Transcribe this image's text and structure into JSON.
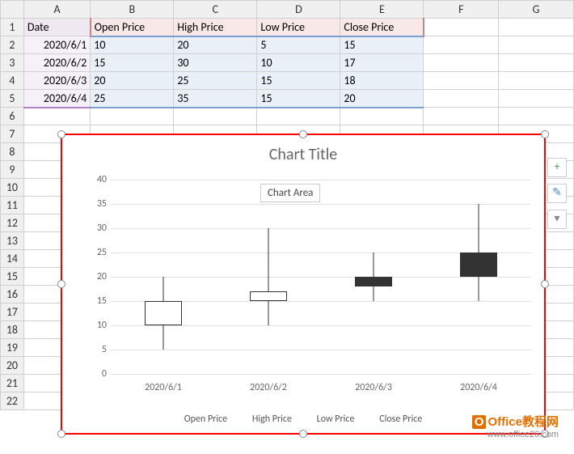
{
  "columns": [
    "A",
    "B",
    "C",
    "D",
    "E",
    "F",
    "G"
  ],
  "rows": [
    "1",
    "2",
    "3",
    "4",
    "5",
    "6",
    "7",
    "8",
    "9",
    "10",
    "11",
    "12",
    "13",
    "14",
    "15",
    "16",
    "17",
    "18",
    "19",
    "20",
    "21",
    "22"
  ],
  "headers": {
    "date": "Date",
    "open": "Open Price",
    "high": "High Price",
    "low": "Low Price",
    "close": "Close Price"
  },
  "table": [
    {
      "date": "2020/6/1",
      "open": 10,
      "high": 20,
      "low": 5,
      "close": 15
    },
    {
      "date": "2020/6/2",
      "open": 15,
      "high": 30,
      "low": 10,
      "close": 17
    },
    {
      "date": "2020/6/3",
      "open": 20,
      "high": 25,
      "low": 15,
      "close": 18
    },
    {
      "date": "2020/6/4",
      "open": 25,
      "high": 35,
      "low": 15,
      "close": 20
    }
  ],
  "chart": {
    "title": "Chart Title",
    "area_label": "Chart Area",
    "legend": [
      "Open Price",
      "High Price",
      "Low Price",
      "Close Price"
    ],
    "yticks": [
      0,
      5,
      10,
      15,
      20,
      25,
      30,
      35,
      40
    ]
  },
  "chart_data": {
    "type": "candlestick",
    "title": "Chart Title",
    "xlabel": "",
    "ylabel": "",
    "ylim": [
      0,
      40
    ],
    "categories": [
      "2020/6/1",
      "2020/6/2",
      "2020/6/3",
      "2020/6/4"
    ],
    "series": [
      {
        "name": "Open Price",
        "values": [
          10,
          15,
          20,
          25
        ]
      },
      {
        "name": "High Price",
        "values": [
          20,
          30,
          25,
          35
        ]
      },
      {
        "name": "Low Price",
        "values": [
          5,
          10,
          15,
          15
        ]
      },
      {
        "name": "Close Price",
        "values": [
          15,
          17,
          18,
          20
        ]
      }
    ]
  },
  "watermark": {
    "brand": "Office教程网",
    "url": "www.office26.com"
  }
}
